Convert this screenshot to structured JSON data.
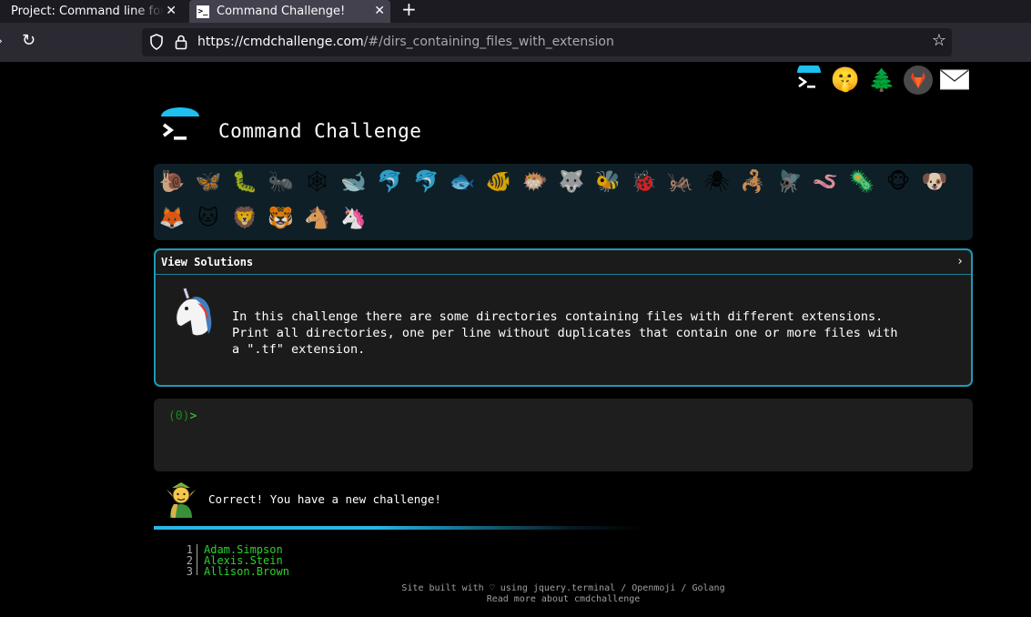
{
  "browser": {
    "tabs": [
      {
        "label": "Project: Command line for t"
      },
      {
        "label": "Command Challenge!"
      }
    ],
    "tab_close_glyph": "✕",
    "new_tab_glyph": "+",
    "url_host": "https://cmdchallenge.com",
    "url_path": "/#/dirs_containing_files_with_extension"
  },
  "header": {
    "title": "Command Challenge",
    "social_icons": [
      "cmdchallenge-logo-icon",
      "shushing-face-icon",
      "tree-icon",
      "gitlab-icon",
      "envelope-icon"
    ],
    "tree_glyph": "🌲",
    "face_glyph": "🤫",
    "accent_color": "#1e9ab8"
  },
  "animals": [
    "🐌",
    "🦋",
    "🐛",
    "🐜",
    "🕸",
    "🐋",
    "🐬",
    "🐬",
    "🐟",
    "🐠",
    "🐡",
    "🐺",
    "🐝",
    "🐞",
    "🦗",
    "🕷",
    "🦂",
    "🪰",
    "🪱",
    "🦠",
    "🐵",
    "🐶",
    "🦊",
    "🐱",
    "🦁",
    "🐯",
    "🐴",
    "🦄"
  ],
  "solutions": {
    "header_label": "View Solutions",
    "chevron": "›",
    "description_lines": [
      "In this challenge there are some directories containing files with different extensions.",
      "Print all directories, one per line without duplicates that contain one or more files with",
      "a \".tf\" extension."
    ]
  },
  "terminal": {
    "prompt_paren": "(",
    "prompt_count": "0",
    "prompt_paren_close": ")",
    "prompt_symbol": ">"
  },
  "feedback": {
    "message": "Correct! You have a new challenge!"
  },
  "output": [
    {
      "n": "1",
      "v": "Adam.Simpson"
    },
    {
      "n": "2",
      "v": "Alexis.Stein"
    },
    {
      "n": "3",
      "v": "Allison.Brown"
    }
  ],
  "footer": {
    "line1": "Site built with ♡ using jquery.terminal / Openmoji / Golang",
    "line2": "Read more about cmdchallenge"
  }
}
